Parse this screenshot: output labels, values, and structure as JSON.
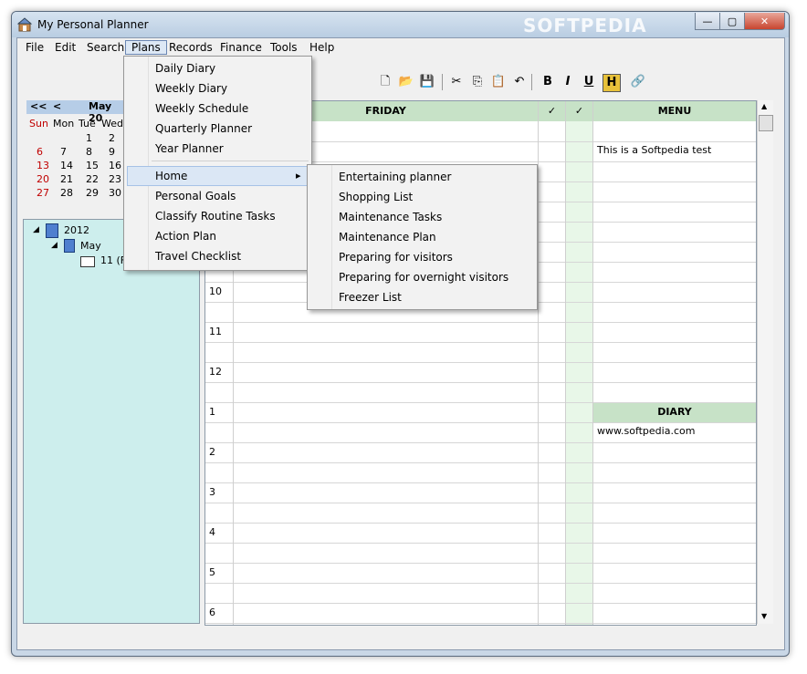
{
  "window": {
    "title": "My Personal Planner",
    "watermark": "SOFTPEDIA"
  },
  "menubar": [
    "File",
    "Edit",
    "Search",
    "Plans",
    "Records",
    "Finance",
    "Tools",
    "Help"
  ],
  "calendar": {
    "nav_prev_year": "<<",
    "nav_prev_month": "<",
    "month_label": "May 20",
    "weekdays": [
      "Sun",
      "Mon",
      "Tue",
      "Wed"
    ],
    "rows": [
      [
        "",
        "",
        "1",
        "2"
      ],
      [
        "6",
        "7",
        "8",
        "9"
      ],
      [
        "13",
        "14",
        "15",
        "16"
      ],
      [
        "20",
        "21",
        "22",
        "23"
      ],
      [
        "27",
        "28",
        "29",
        "30"
      ]
    ]
  },
  "tree": {
    "year": "2012",
    "month": "May",
    "day": "11 (Fr"
  },
  "grid": {
    "day_header": "FRIDAY",
    "check1": "✓",
    "check2": "✓",
    "menu_header": "MENU",
    "menu_text": "This is a Softpedia test",
    "diary_header": "DIARY",
    "diary_text": "www.softpedia.com",
    "times": [
      "10",
      "11",
      "12",
      "1",
      "2",
      "3",
      "4",
      "5",
      "6"
    ]
  },
  "plans_menu": {
    "items": [
      "Daily Diary",
      "Weekly Diary",
      "Weekly Schedule",
      "Quarterly Planner",
      "Year Planner",
      "Home",
      "Personal Goals",
      "Classify Routine Tasks",
      "Action Plan",
      "Travel Checklist"
    ],
    "submenu_arrow": "▸"
  },
  "home_submenu": {
    "items": [
      "Entertaining planner",
      "Shopping List",
      "Maintenance Tasks",
      "Maintenance Plan",
      "Preparing for visitors",
      "Preparing for overnight visitors",
      "Freezer List"
    ]
  },
  "icons": [
    "new-document-icon",
    "open-folder-icon",
    "save-icon",
    "cut-icon",
    "copy-icon",
    "paste-icon",
    "undo-icon",
    "bold-icon",
    "italic-icon",
    "underline-icon",
    "highlight-icon",
    "link-icon"
  ],
  "colors": {
    "header_green": "#c7e2c7",
    "tree_bg": "#cdeeed",
    "weekend_red": "#c00000"
  }
}
